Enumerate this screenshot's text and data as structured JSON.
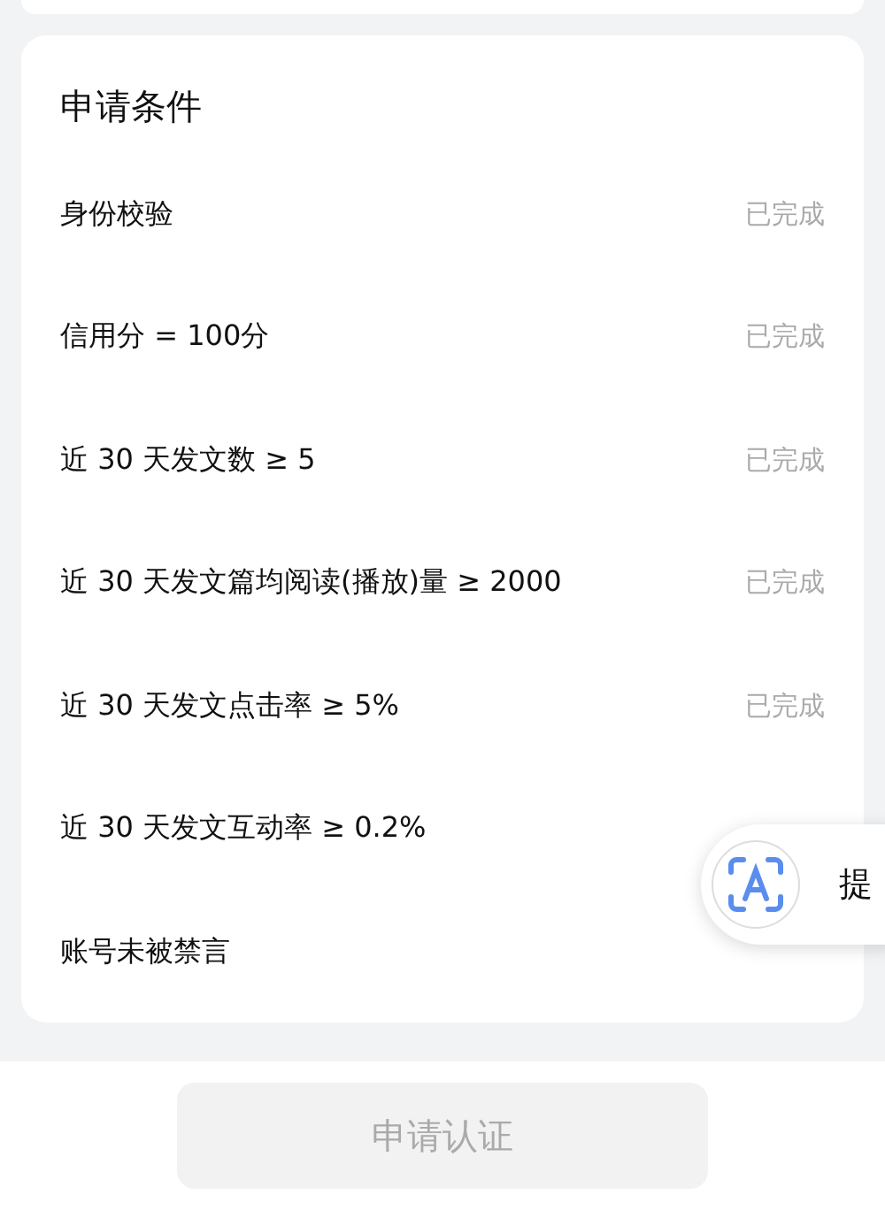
{
  "conditions_card": {
    "title": "申请条件",
    "items": [
      {
        "label": "身份校验",
        "status": "已完成"
      },
      {
        "label": "信用分 = 100分",
        "status": "已完成"
      },
      {
        "label": "近 30 天发文数 ≥ 5",
        "status": "已完成"
      },
      {
        "label": "近 30 天发文篇均阅读(播放)量 ≥ 2000",
        "status": "已完成"
      },
      {
        "label": "近 30 天发文点击率 ≥ 5%",
        "status": "已完成"
      },
      {
        "label": "近 30 天发文互动率 ≥ 0.2%"
      },
      {
        "label": "账号未被禁言"
      }
    ]
  },
  "floating_button": {
    "label": "提"
  },
  "apply_button": {
    "label": "申请认证",
    "disabled": true
  }
}
